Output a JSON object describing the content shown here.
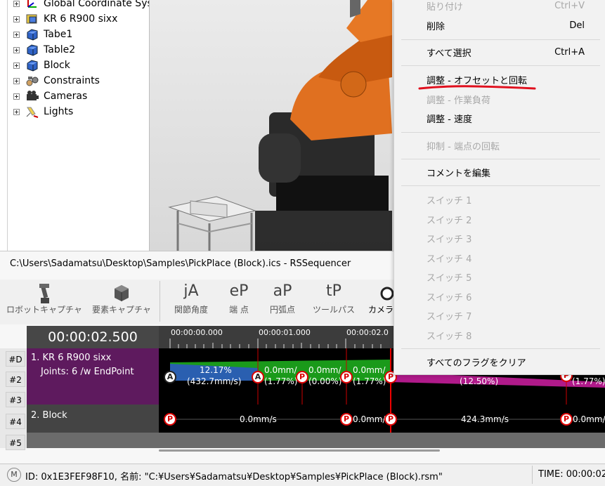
{
  "tree": {
    "items": [
      {
        "label": "Global Coordinate Sys",
        "icon": "coordinate-system-icon"
      },
      {
        "label": "KR 6 R900 sixx",
        "icon": "robot-icon"
      },
      {
        "label": "Tabe1",
        "icon": "cube-icon"
      },
      {
        "label": "Table2",
        "icon": "cube-icon"
      },
      {
        "label": "Block",
        "icon": "cube-icon"
      },
      {
        "label": "Constraints",
        "icon": "constraints-icon"
      },
      {
        "label": "Cameras",
        "icon": "camera-icon"
      },
      {
        "label": "Lights",
        "icon": "light-icon"
      }
    ]
  },
  "context_menu": {
    "items": [
      {
        "label": "貼り付け",
        "shortcut": "Ctrl+V",
        "disabled": true
      },
      {
        "label": "削除",
        "shortcut": "Del",
        "disabled": false
      },
      {
        "label": "すべて選択",
        "shortcut": "Ctrl+A",
        "disabled": false
      },
      {
        "label": "調整 - オフセットと回転",
        "shortcut": "",
        "disabled": false
      },
      {
        "label": "調整 - 作業負荷",
        "shortcut": "",
        "disabled": true
      },
      {
        "label": "調整 - 速度",
        "shortcut": "",
        "disabled": false
      },
      {
        "label": "抑制 - 端点の回転",
        "shortcut": "",
        "disabled": true
      },
      {
        "label": "コメントを編集",
        "shortcut": "",
        "disabled": false
      },
      {
        "label": "スイッチ 1",
        "shortcut": "",
        "disabled": true
      },
      {
        "label": "スイッチ 2",
        "shortcut": "",
        "disabled": true
      },
      {
        "label": "スイッチ 3",
        "shortcut": "",
        "disabled": true
      },
      {
        "label": "スイッチ 4",
        "shortcut": "",
        "disabled": true
      },
      {
        "label": "スイッチ 5",
        "shortcut": "",
        "disabled": true
      },
      {
        "label": "スイッチ 6",
        "shortcut": "",
        "disabled": true
      },
      {
        "label": "スイッチ 7",
        "shortcut": "",
        "disabled": true
      },
      {
        "label": "スイッチ 8",
        "shortcut": "",
        "disabled": true
      },
      {
        "label": "すべてのフラグをクリア",
        "shortcut": "",
        "disabled": false
      }
    ],
    "highlight_color": "#e0101e"
  },
  "sequencer": {
    "title": "C:\\Users\\Sadamatsu\\Desktop\\Samples\\PickPlace (Block).ics - RSSequencer",
    "toolbar": [
      {
        "label": "ロボットキャプチャ",
        "icon": "robot-capture-icon"
      },
      {
        "label": "要素キャプチャ",
        "icon": "element-capture-icon"
      },
      {
        "label": "関節角度",
        "glyph": "jA",
        "icon": "joint-angle-icon"
      },
      {
        "label": "端 点",
        "glyph": "eP",
        "icon": "end-point-icon"
      },
      {
        "label": "円弧点",
        "glyph": "aP",
        "icon": "arc-point-icon"
      },
      {
        "label": "ツールパス",
        "glyph": "tP",
        "icon": "tool-path-icon"
      },
      {
        "label": "カメラ",
        "icon": "camera-icon"
      }
    ],
    "timecode": "00:00:02.500",
    "ticks": [
      "00:00:00.000",
      "00:00:01.000",
      "00:00:02.0"
    ],
    "row_numbers": [
      "#D",
      "#2",
      "#3",
      "#4",
      "#5"
    ],
    "tracks": [
      {
        "label_line1": "1.  KR 6 R900 sixx",
        "label_line2": "Joints: 6 /w EndPoint",
        "color": "#5e1a5e",
        "values_top": [
          "12.17%",
          "0.0mm/",
          "0.0mm/",
          "0.0mm/"
        ],
        "values_bottom": [
          "(432.7mm/s)",
          "(1.77%)",
          "(0.00%)",
          "(1.77%)",
          "(12.50%)",
          "(1.77%)"
        ],
        "markers": [
          "A",
          "A",
          "P",
          "P",
          "P",
          "P"
        ]
      },
      {
        "label_line1": "2.  Block",
        "color": "#444444",
        "values": [
          "0.0mm/s",
          "0.0mm/",
          "424.3mm/s",
          "0.0mm/"
        ],
        "markers": [
          "P",
          "P",
          "P",
          "P"
        ]
      }
    ]
  },
  "status": {
    "badge": "M",
    "text": "ID: 0x1E3FEF98F10, 名前: \"C:¥Users¥Sadamatsu¥Desktop¥Samples¥PickPlace (Block).rsm\"",
    "time": "TIME: 00:00:02."
  }
}
